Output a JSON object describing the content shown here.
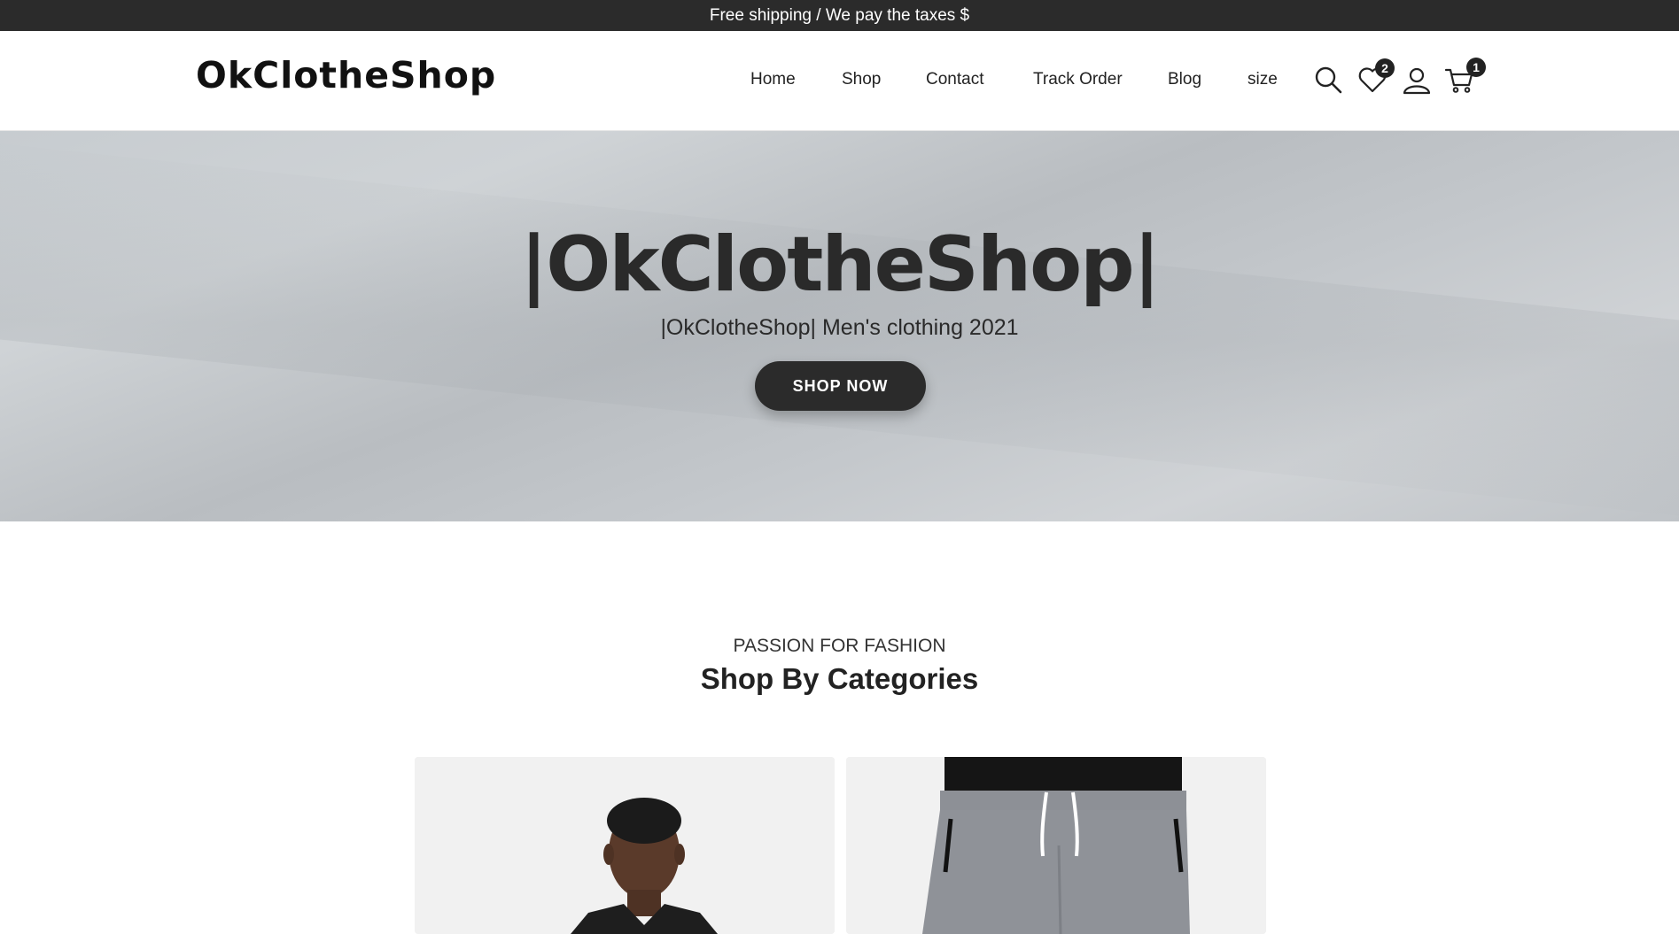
{
  "announcement": "Free shipping / We pay the taxes $",
  "header": {
    "logo": "OkClotheShop",
    "nav": [
      "Home",
      "Shop",
      "Contact",
      "Track Order",
      "Blog",
      "size"
    ],
    "wishlist_count": "2",
    "cart_count": "1",
    "icons": [
      "search-icon",
      "heart-icon",
      "user-icon",
      "cart-icon"
    ]
  },
  "hero": {
    "title": "|OkClotheShop|",
    "subtitle": "|OkClotheShop| Men's clothing 2021",
    "button": "SHOP NOW"
  },
  "categories": {
    "kicker": "PASSION FOR FASHION",
    "title": "Shop By Categories"
  },
  "colors": {
    "dark": "#2b2b2b",
    "hero_bg": "#c3c7cb",
    "card_bg": "#f1f1f1"
  }
}
